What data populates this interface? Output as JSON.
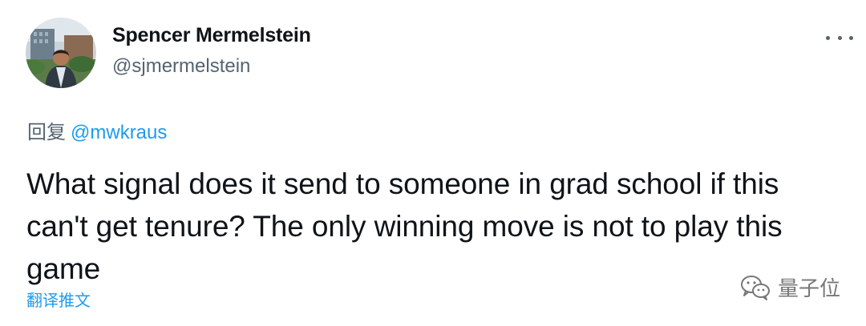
{
  "author": {
    "name": "Spencer Mermelstein",
    "handle": "@sjmermelstein",
    "avatar_icon": "profile-photo"
  },
  "more_icon": "more-options-icon",
  "reply": {
    "prefix": "回复",
    "mention": "@mwkraus"
  },
  "tweet": {
    "text": "What signal does it send to someone in grad school if this can't get tenure? The only winning move is not to play this game"
  },
  "translate_label": "翻译推文",
  "watermark": {
    "text": "量子位",
    "icon": "wechat-icon"
  },
  "colors": {
    "link": "#1d9bf0",
    "secondary": "#536471",
    "text": "#0f1419"
  }
}
